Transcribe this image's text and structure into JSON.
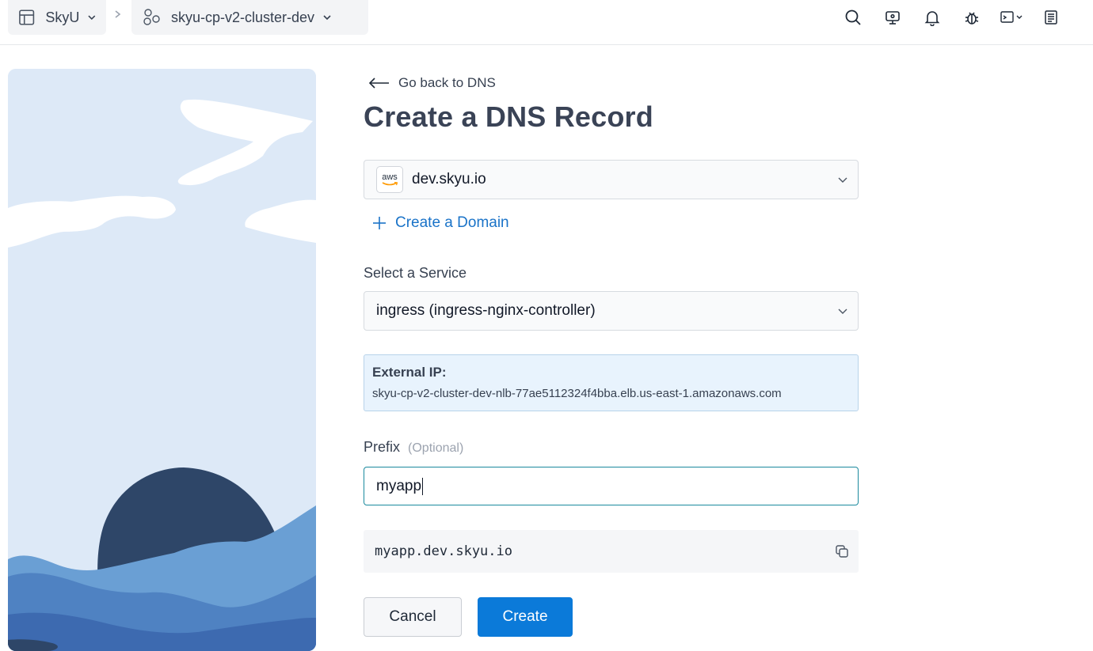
{
  "breadcrumb": {
    "org": "SkyU",
    "project": "skyu-cp-v2-cluster-dev",
    "separator": ">"
  },
  "page": {
    "back_link": "Go back to DNS",
    "title": "Create a DNS Record"
  },
  "domain_select": {
    "provider_logo": "aws",
    "value": "dev.skyu.io"
  },
  "create_domain": {
    "label": "Create a Domain"
  },
  "service": {
    "label": "Select a Service",
    "value": "ingress (ingress-nginx-controller)"
  },
  "external_ip": {
    "label": "External IP:",
    "value": "skyu-cp-v2-cluster-dev-nlb-77ae5112324f4bba.elb.us-east-1.amazonaws.com"
  },
  "prefix": {
    "label": "Prefix",
    "optional": "(Optional)",
    "value": "myapp"
  },
  "fqdn": {
    "value": "myapp.dev.skyu.io"
  },
  "actions": {
    "cancel": "Cancel",
    "create": "Create"
  },
  "colors": {
    "primary": "#0b7ad9",
    "link": "#1a73c8",
    "info_bg": "#e8f3fd",
    "title": "#3a4356"
  },
  "icons": [
    "table-icon",
    "chevron-down-icon",
    "chevron-right-icon",
    "cluster-icon",
    "search-icon",
    "monitor-icon",
    "bell-icon",
    "bug-icon",
    "terminal-icon",
    "document-icon",
    "arrow-left-icon",
    "plus-icon",
    "copy-icon"
  ]
}
